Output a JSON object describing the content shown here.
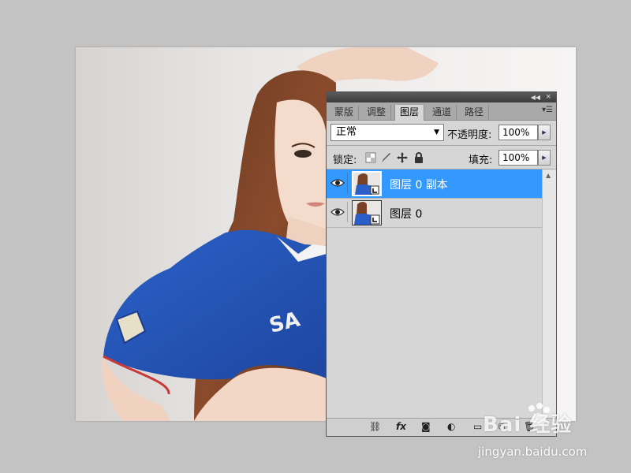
{
  "panel": {
    "tabs": [
      {
        "label": "蒙版"
      },
      {
        "label": "调整"
      },
      {
        "label": "图层"
      },
      {
        "label": "通道"
      },
      {
        "label": "路径"
      }
    ],
    "blend_mode": "正常",
    "opacity_label": "不透明度:",
    "opacity_value": "100%",
    "lock_label": "锁定:",
    "fill_label": "填充:",
    "fill_value": "100%",
    "layers": [
      {
        "name": "图层 0 副本",
        "selected": true,
        "visible": true
      },
      {
        "name": "图层 0",
        "selected": false,
        "visible": true
      }
    ],
    "bottom_icons": [
      "link-icon",
      "fx-icon",
      "mask-icon",
      "adjustment-icon",
      "group-folder-icon",
      "new-layer-icon",
      "trash-icon"
    ],
    "fx_label": "fx"
  },
  "watermark": {
    "logo": "Bai 经验",
    "url": "jingyan.baidu.com"
  },
  "colors": {
    "selection": "#3399ff",
    "jersey": "#2a5cbe"
  }
}
